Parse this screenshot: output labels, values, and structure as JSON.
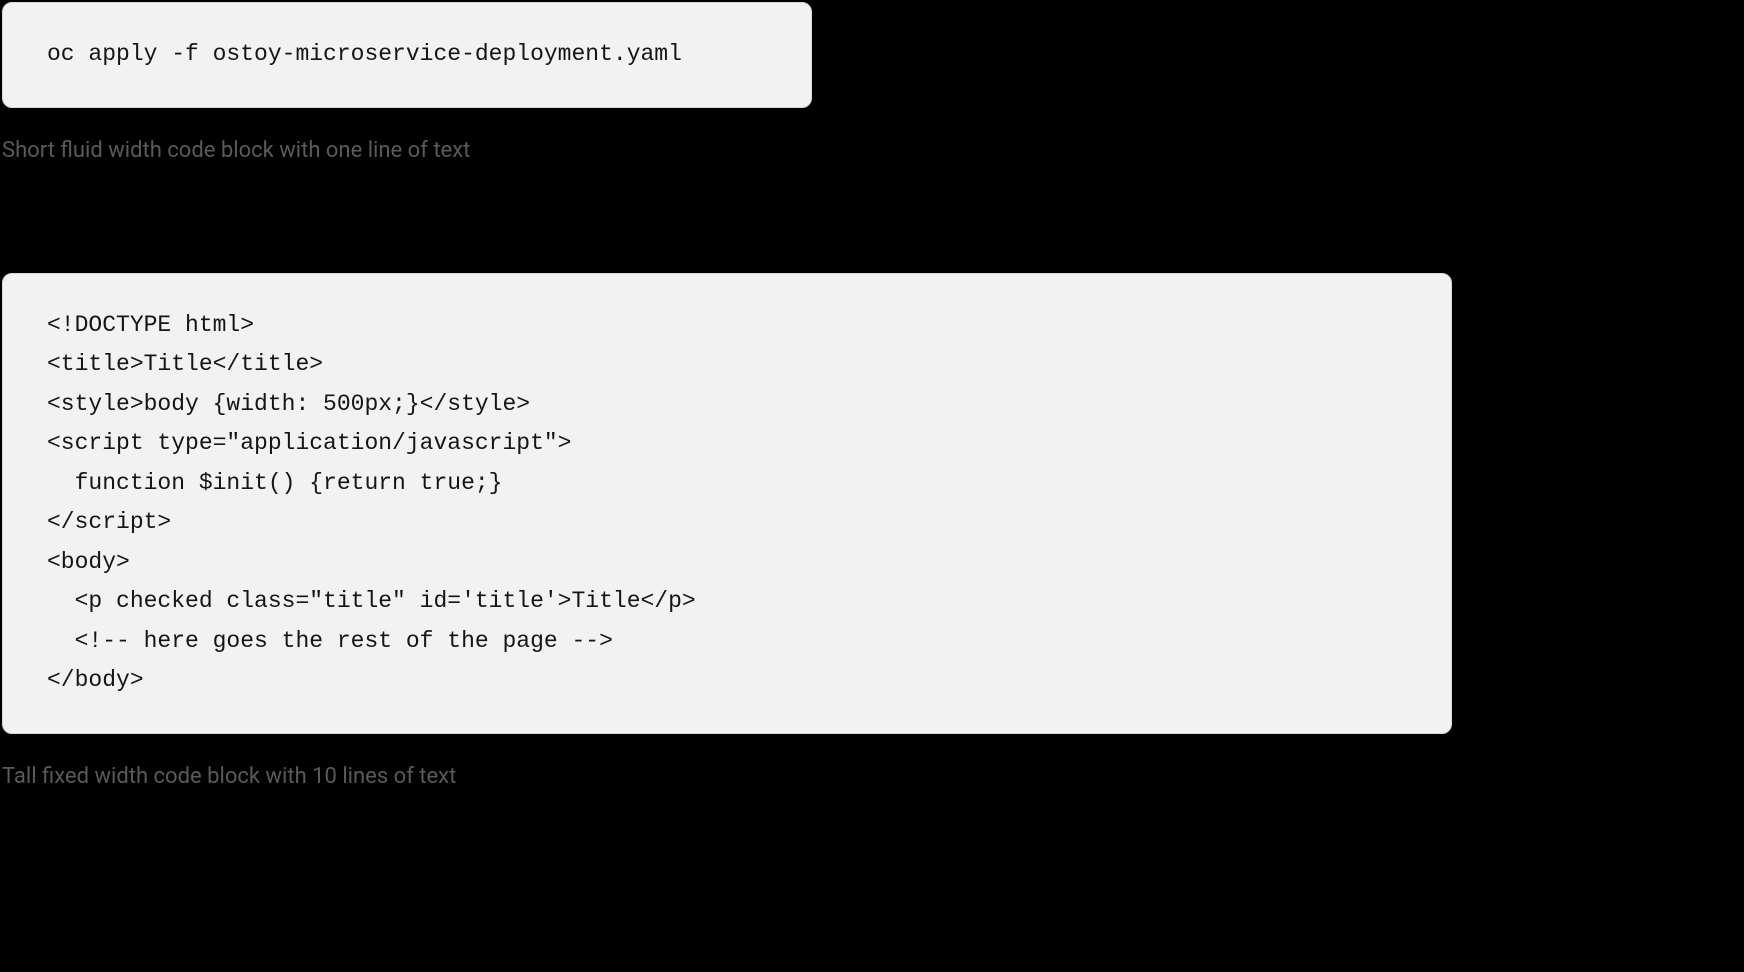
{
  "blocks": [
    {
      "type": "short",
      "code": "oc apply -f ostoy-microservice-deployment.yaml",
      "caption": "Short fluid width code block with one line of text"
    },
    {
      "type": "tall",
      "code": "<!DOCTYPE html>\n<title>Title</title>\n<style>body {width: 500px;}</style>\n<script type=\"application/javascript\">\n  function $init() {return true;}\n</script>\n<body>\n  <p checked class=\"title\" id='title'>Title</p>\n  <!-- here goes the rest of the page -->\n</body>",
      "caption": "Tall fixed width code block with 10 lines of text"
    }
  ]
}
